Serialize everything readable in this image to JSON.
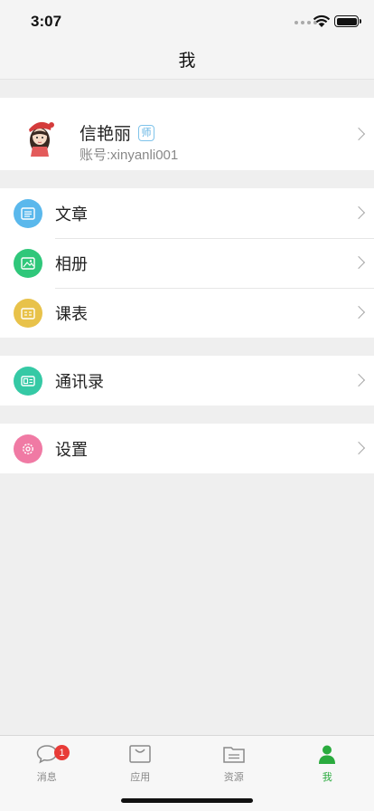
{
  "status_bar": {
    "time": "3:07"
  },
  "nav": {
    "title": "我"
  },
  "profile": {
    "name": "信艳丽",
    "badge": "师",
    "account": "账号:xinyanli001"
  },
  "menu": {
    "group1": [
      {
        "label": "文章",
        "icon": "article-icon",
        "color": "#5ab8ec"
      },
      {
        "label": "相册",
        "icon": "album-icon",
        "color": "#2fc77a"
      },
      {
        "label": "课表",
        "icon": "schedule-icon",
        "color": "#e8c24a"
      }
    ],
    "group2": [
      {
        "label": "通讯录",
        "icon": "contacts-icon",
        "color": "#35c9a5"
      }
    ],
    "group3": [
      {
        "label": "设置",
        "icon": "settings-icon",
        "color": "#f07aa4"
      }
    ]
  },
  "tabs": [
    {
      "label": "消息",
      "icon": "message-icon",
      "badge": "1"
    },
    {
      "label": "应用",
      "icon": "apps-icon"
    },
    {
      "label": "资源",
      "icon": "folder-icon"
    },
    {
      "label": "我",
      "icon": "person-icon",
      "active": true
    }
  ],
  "colors": {
    "active_tab": "#2aab3e",
    "badge": "#e83b37"
  }
}
